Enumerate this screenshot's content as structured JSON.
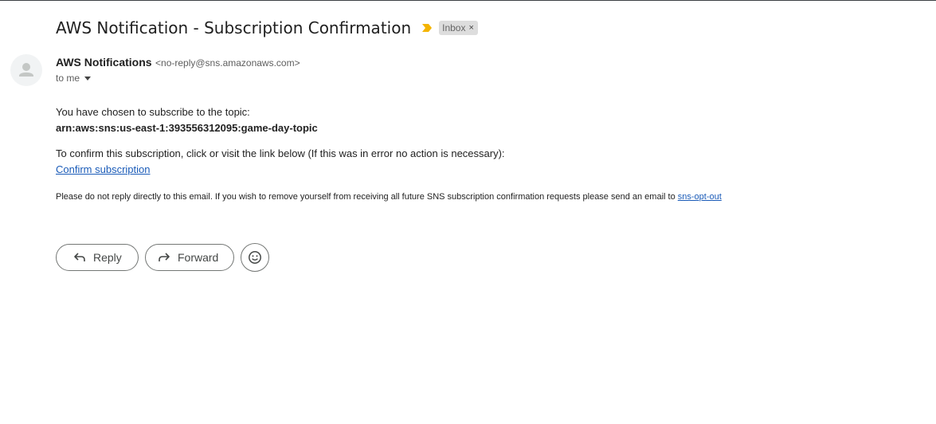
{
  "email": {
    "subject": "AWS Notification - Subscription Confirmation",
    "label": "Inbox",
    "label_close": "×",
    "sender_name": "AWS Notifications",
    "sender_email": "<no-reply@sns.amazonaws.com>",
    "recipient": "to me"
  },
  "body": {
    "line1": "You have chosen to subscribe to the topic:",
    "topic_arn": "arn:aws:sns:us-east-1:393556312095:game-day-topic",
    "line2": "To confirm this subscription, click or visit the link below (If this was in error no action is necessary):",
    "confirm_link": "Confirm subscription",
    "fine_print": "Please do not reply directly to this email. If you wish to remove yourself from receiving all future SNS subscription confirmation requests please send an email to",
    "opt_out_link": "sns-opt-out"
  },
  "actions": {
    "reply_label": "Reply",
    "forward_label": "Forward"
  },
  "colors": {
    "important_marker": "#f4b400",
    "link": "#1a5bb8",
    "label_chip_bg": "#dddddd"
  },
  "icons": {
    "important": "important-marker-icon",
    "avatar": "person-icon",
    "reply": "reply-arrow-icon",
    "forward": "forward-arrow-icon",
    "emoji": "smiley-icon",
    "caret": "caret-down-icon"
  }
}
